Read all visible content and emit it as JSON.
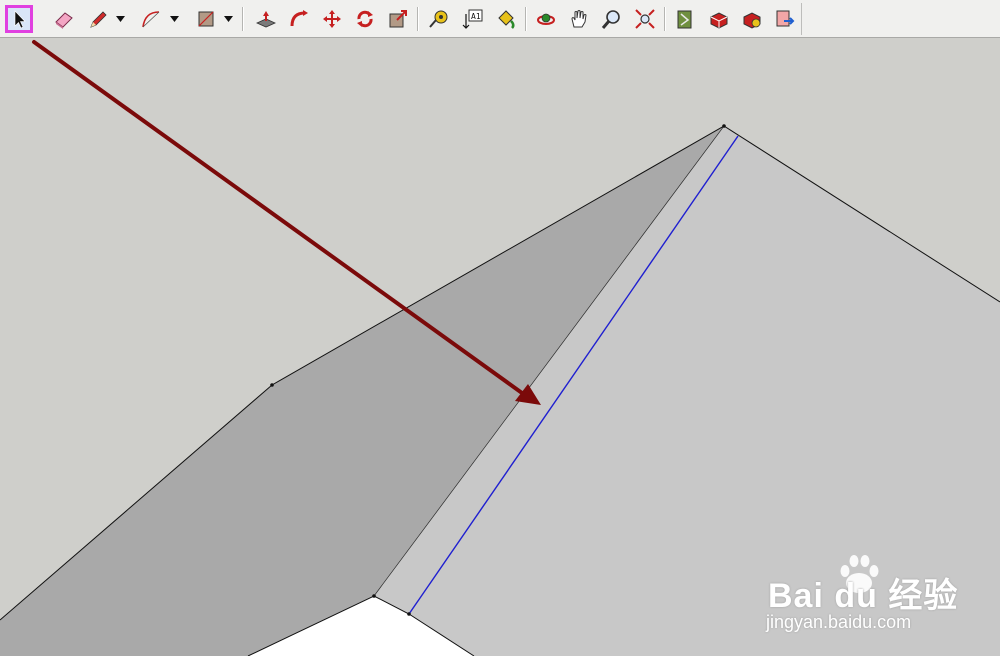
{
  "toolbar": {
    "tools": [
      {
        "id": "select",
        "icon": "select-arrow-icon",
        "active": true
      },
      {
        "id": "eraser",
        "icon": "eraser-icon"
      },
      {
        "id": "pencil",
        "icon": "pencil-icon"
      },
      {
        "id": "arc",
        "icon": "arc-icon"
      },
      {
        "id": "rectangle",
        "icon": "rectangle-icon"
      },
      {
        "id": "push-pull",
        "icon": "push-pull-icon"
      },
      {
        "id": "follow-me",
        "icon": "follow-me-icon"
      },
      {
        "id": "move",
        "icon": "move-icon"
      },
      {
        "id": "rotate",
        "icon": "rotate-icon"
      },
      {
        "id": "offset",
        "icon": "offset-icon"
      },
      {
        "id": "tape-measure",
        "icon": "tape-measure-icon"
      },
      {
        "id": "text",
        "icon": "text-tool-icon",
        "glyph": "A1"
      },
      {
        "id": "paint-bucket",
        "icon": "paint-bucket-icon"
      },
      {
        "id": "orbit",
        "icon": "orbit-icon"
      },
      {
        "id": "pan",
        "icon": "pan-hand-icon"
      },
      {
        "id": "zoom",
        "icon": "zoom-icon"
      },
      {
        "id": "zoom-extents",
        "icon": "zoom-extents-icon"
      },
      {
        "id": "3d-warehouse",
        "icon": "3d-warehouse-icon"
      },
      {
        "id": "get-models",
        "icon": "get-models-icon"
      },
      {
        "id": "share-component",
        "icon": "share-component-icon"
      },
      {
        "id": "send-to-layout",
        "icon": "send-to-layout-icon"
      }
    ],
    "colors": {
      "active_border": "#e040e0",
      "active_bg": "#d9e6f8"
    }
  },
  "scene": {
    "colors": {
      "background": "#cfcfcb",
      "dark_face": "#a9a9a9",
      "light_face": "#c8c8c8",
      "white_area": "#ffffff",
      "edge": "#111111",
      "selected_edge": "#1f1fd0",
      "annotation_arrow": "#7b0a0a"
    }
  },
  "watermark": {
    "brand": "Bai du 经验",
    "site": "jingyan.baidu.com"
  }
}
